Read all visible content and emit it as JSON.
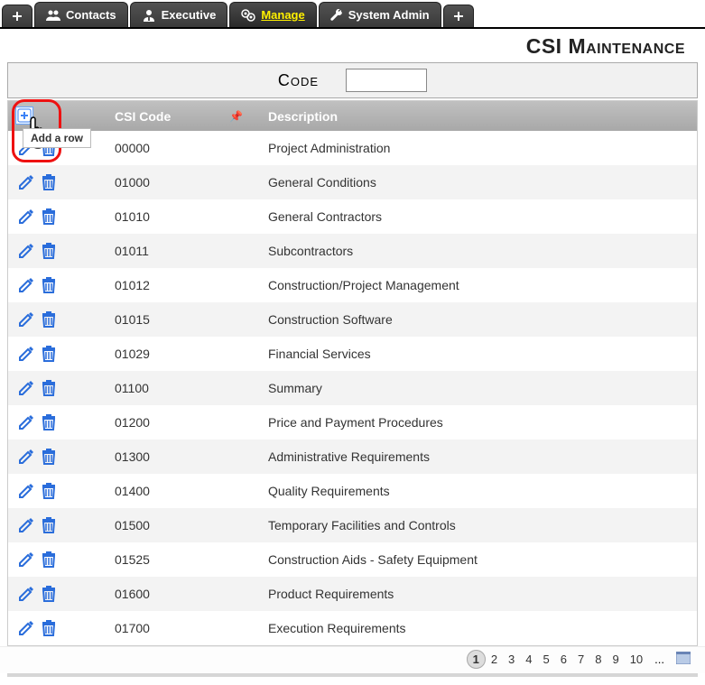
{
  "tabs": [
    {
      "icon": "plus",
      "label": ""
    },
    {
      "icon": "contacts",
      "label": "Contacts"
    },
    {
      "icon": "executive",
      "label": "Executive"
    },
    {
      "icon": "manage",
      "label": "Manage",
      "active": true
    },
    {
      "icon": "wrench",
      "label": "System Admin"
    },
    {
      "icon": "plus",
      "label": ""
    }
  ],
  "page_title": "CSI Maintenance",
  "search": {
    "label": "Code",
    "placeholder": ""
  },
  "columns": {
    "actions": "",
    "code": "CSI Code",
    "desc": "Description"
  },
  "add_hint": "Add a row",
  "rows": [
    {
      "code": "00000",
      "desc": "Project Administration"
    },
    {
      "code": "01000",
      "desc": "General Conditions"
    },
    {
      "code": "01010",
      "desc": "General Contractors"
    },
    {
      "code": "01011",
      "desc": "Subcontractors"
    },
    {
      "code": "01012",
      "desc": "Construction/Project Management"
    },
    {
      "code": "01015",
      "desc": "Construction Software"
    },
    {
      "code": "01029",
      "desc": "Financial Services"
    },
    {
      "code": "01100",
      "desc": "Summary"
    },
    {
      "code": "01200",
      "desc": "Price and Payment Procedures"
    },
    {
      "code": "01300",
      "desc": "Administrative Requirements"
    },
    {
      "code": "01400",
      "desc": "Quality Requirements"
    },
    {
      "code": "01500",
      "desc": "Temporary Facilities and Controls"
    },
    {
      "code": "01525",
      "desc": "Construction Aids - Safety Equipment"
    },
    {
      "code": "01600",
      "desc": "Product Requirements"
    },
    {
      "code": "01700",
      "desc": "Execution Requirements"
    }
  ],
  "pagination": {
    "pages": [
      1,
      2,
      3,
      4,
      5,
      6,
      7,
      8,
      9,
      10
    ],
    "current": 1,
    "ellipsis": "..."
  },
  "colors": {
    "link_blue": "#2a6ddb",
    "highlight": "#e11"
  }
}
